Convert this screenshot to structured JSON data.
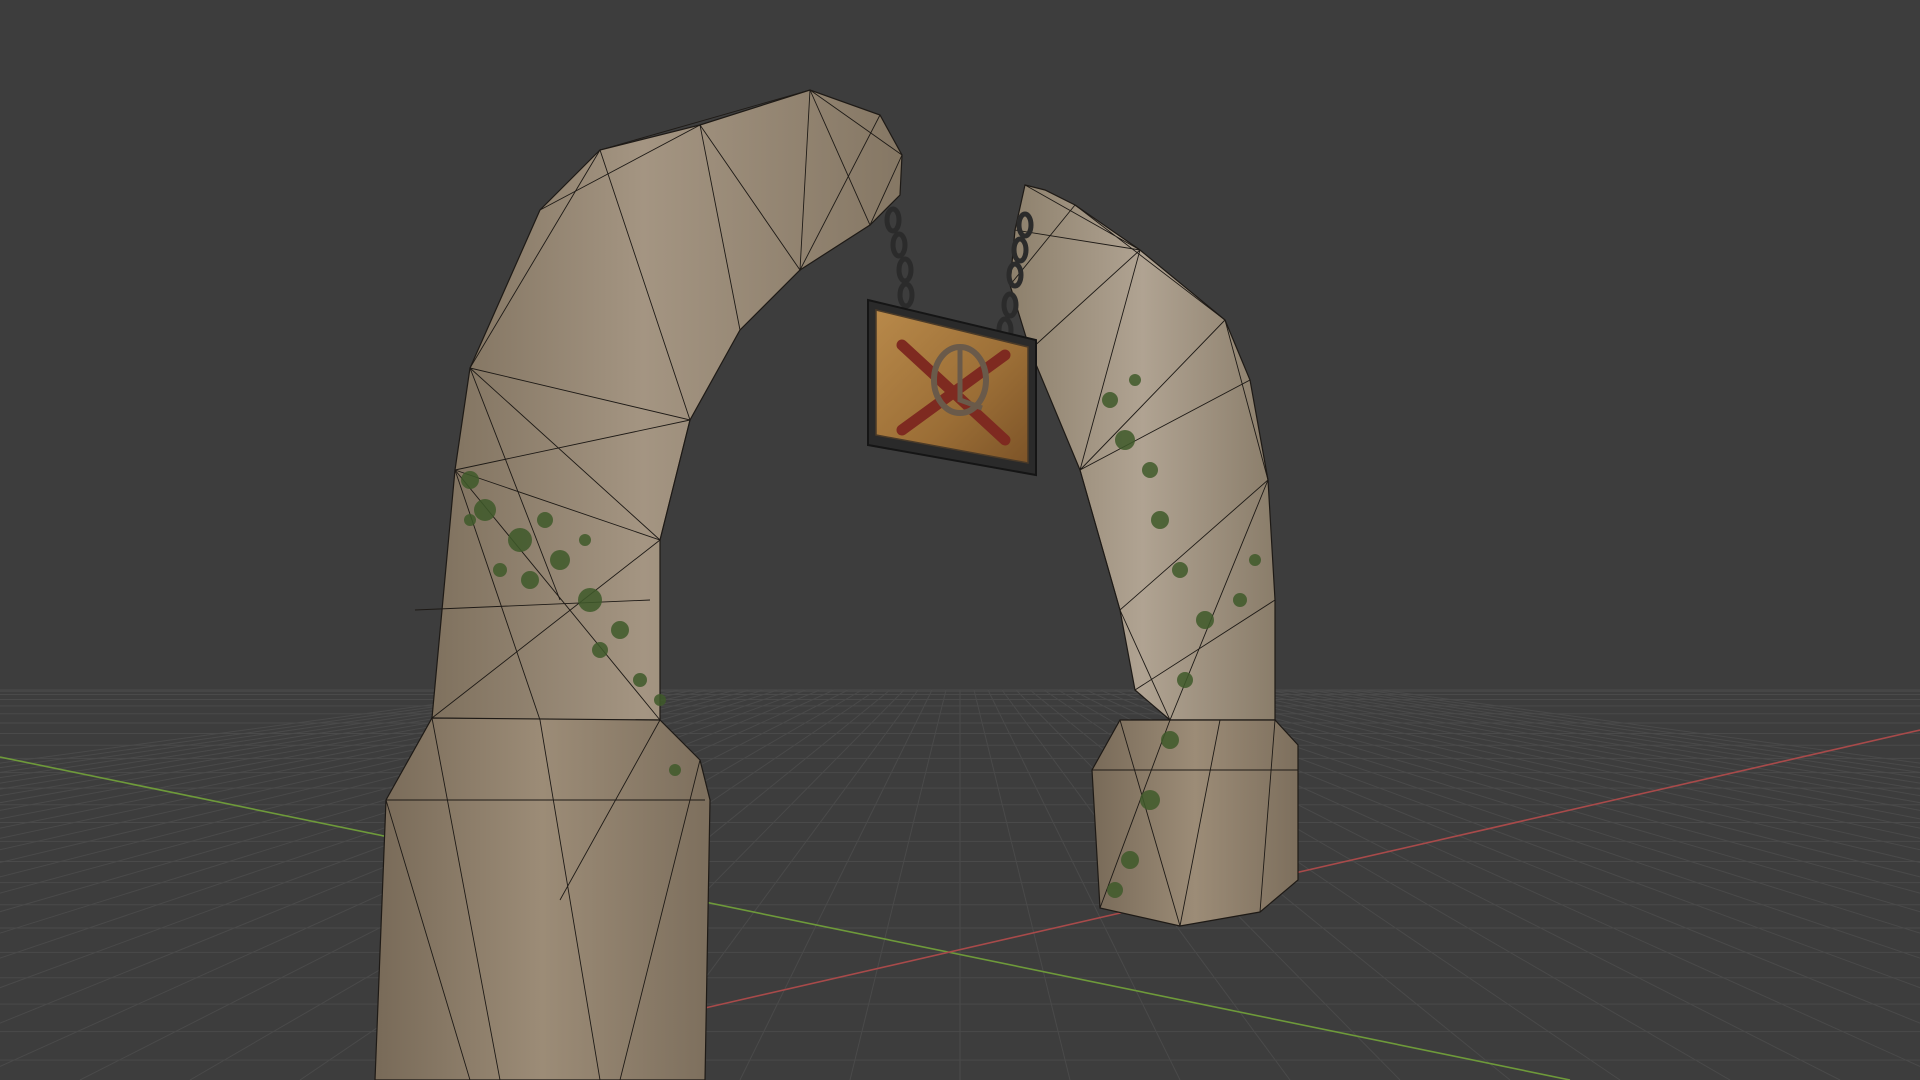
{
  "viewport": {
    "background_color": "#3d3d3d",
    "grid_line_color": "#4a4a4a",
    "x_axis_color": "#a84a4a",
    "y_axis_color": "#6e9a3a"
  },
  "scene": {
    "object": "stone-arch-with-hanging-sign",
    "shading_mode": "textured",
    "wireframe_overlay": true,
    "stone_color": "#9a8a74",
    "ivy_color": "#3f5a2a",
    "sign_wood_color": "#a6783c",
    "sign_emblem_color": "#7e2a20",
    "chain_color": "#2b2b2b"
  }
}
